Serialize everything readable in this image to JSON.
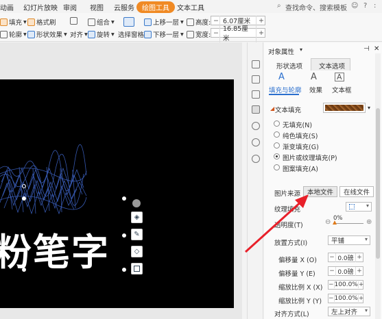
{
  "menubar": {
    "tabs": [
      "动画",
      "幻灯片放映",
      "审阅",
      "视图",
      "云服务",
      "绘图工具",
      "文本工具"
    ],
    "search": "查找命令、搜索模板"
  },
  "ribbon": {
    "fill": "填充",
    "format_brush": "格式刷",
    "outline": "轮廓",
    "shape_effect": "形状效果",
    "align": "对齐",
    "group": "组合",
    "rotate": "旋转",
    "selection_pane": "选择窗格",
    "bring_forward": "上移一层",
    "send_backward": "下移一层",
    "height_label": "高度:",
    "height_value": "6.07厘米",
    "width_label": "宽度:",
    "width_value": "16.85厘米"
  },
  "slide": {
    "text": "粉笔字"
  },
  "panel": {
    "title": "对象属性",
    "tab_shape": "形状选项",
    "tab_text": "文本选项",
    "sub_fill_outline": "填充与轮廓",
    "sub_effect": "效果",
    "sub_textbox": "文本框",
    "section_text_fill": "文本填充",
    "fill_options": [
      "无填充(N)",
      "纯色填充(S)",
      "渐变填充(G)",
      "图片或纹理填充(P)",
      "图案填充(A)"
    ],
    "picture_source": "图片来源",
    "local_file": "本地文件",
    "online_file": "在线文件",
    "texture_fill": "纹理填充",
    "transparency": "透明度(T)",
    "transparency_value": "0%",
    "placement": "放置方式(I)",
    "placement_value": "平铺",
    "offset_x": "偏移量 X (O)",
    "offset_x_value": "0.0磅",
    "offset_y": "偏移量 Y (E)",
    "offset_y_value": "0.0磅",
    "scale_x": "缩放比例 X (X)",
    "scale_x_value": "100.0%",
    "scale_y": "缩放比例 Y (Y)",
    "scale_y_value": "100.0%",
    "alignment": "对齐方式(L)",
    "alignment_value": "左上对齐"
  }
}
